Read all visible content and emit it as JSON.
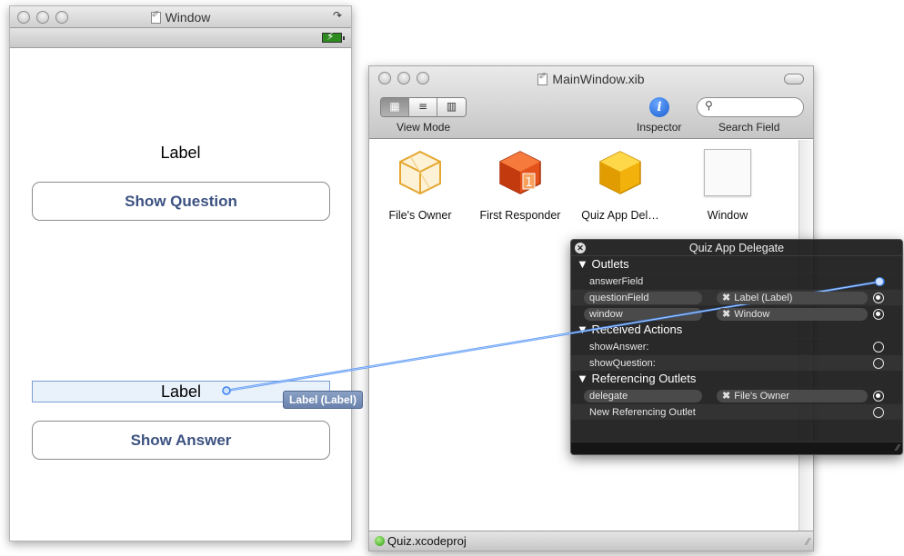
{
  "iphone_window": {
    "title": "Window",
    "label_top": "Label",
    "show_question": "Show Question",
    "label_bottom": "Label",
    "show_answer": "Show Answer"
  },
  "xib_window": {
    "title": "MainWindow.xib",
    "view_mode_label": "View Mode",
    "inspector_label": "Inspector",
    "search_label": "Search Field",
    "items": [
      {
        "caption": "File's Owner",
        "icon": "cube-outline-icon"
      },
      {
        "caption": "First Responder",
        "icon": "first-responder-cube-icon"
      },
      {
        "caption": "Quiz App Del…",
        "icon": "gold-cube-icon"
      },
      {
        "caption": "Window",
        "icon": "window-icon"
      }
    ],
    "status": "Quiz.xcodeproj"
  },
  "hud": {
    "title": "Quiz App Delegate",
    "sections": {
      "outlets": "Outlets",
      "received": "Received Actions",
      "referencing": "Referencing Outlets"
    },
    "outlets": [
      {
        "name": "answerField",
        "connection": ""
      },
      {
        "name": "questionField",
        "connection": "Label (Label)"
      },
      {
        "name": "window",
        "connection": "Window"
      }
    ],
    "actions": [
      {
        "name": "showAnswer:"
      },
      {
        "name": "showQuestion:"
      }
    ],
    "referencing": [
      {
        "name": "delegate",
        "connection": "File's Owner"
      },
      {
        "name": "New Referencing Outlet",
        "connection": ""
      }
    ]
  },
  "drag_tag": "Label (Label)",
  "colors": {
    "connection_line": "#3b82f0",
    "ios_button_text": "#3c5281",
    "hud_bg": "#191919"
  }
}
